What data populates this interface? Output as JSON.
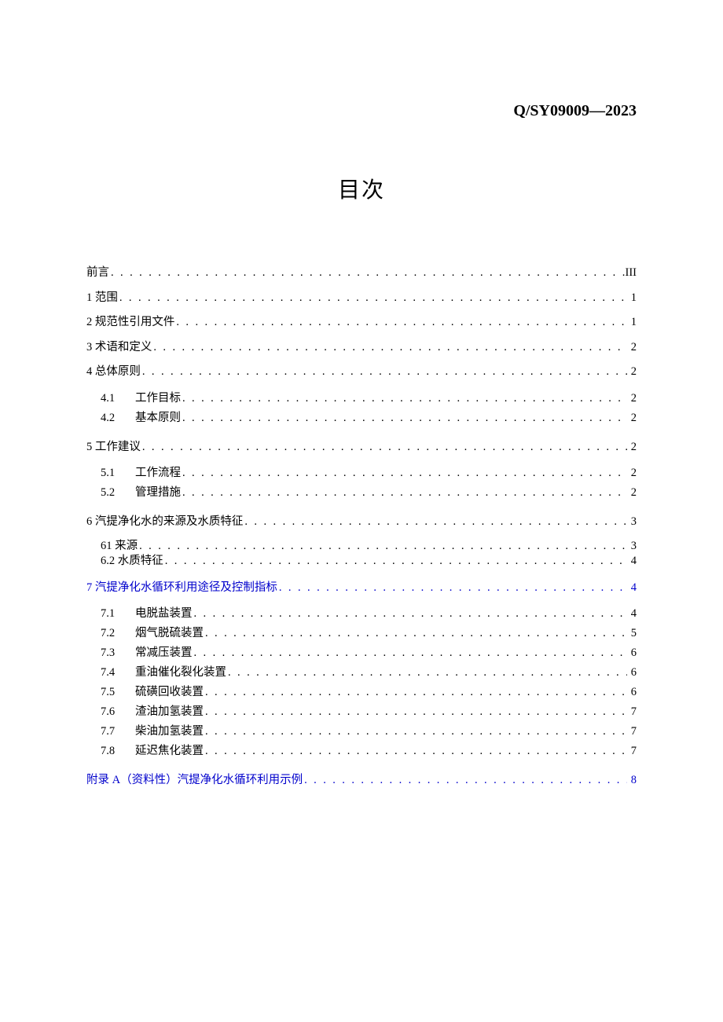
{
  "header": {
    "code": "Q/SY09009—2023"
  },
  "title": "目次",
  "toc": {
    "preface": {
      "label": "前言",
      "page": "III"
    },
    "s1": {
      "num": "1",
      "label": "范围",
      "page": "1"
    },
    "s2": {
      "num": "2",
      "label": "规范性引用文件",
      "page": "1"
    },
    "s3": {
      "num": "3",
      "label": "术语和定义",
      "page": "2"
    },
    "s4": {
      "num": "4",
      "label": "总体原则",
      "page": "2",
      "items": [
        {
          "num": "4.1",
          "label": "工作目标",
          "page": "2"
        },
        {
          "num": "4.2",
          "label": "基本原则",
          "page": "2"
        }
      ]
    },
    "s5": {
      "num": "5",
      "label": "工作建议",
      "page": "2",
      "items": [
        {
          "num": "5.1",
          "label": "工作流程",
          "page": "2"
        },
        {
          "num": "5.2",
          "label": "管理措施",
          "page": "2"
        }
      ]
    },
    "s6": {
      "num": "6",
      "label": "汽提净化水的来源及水质特征",
      "page": "3",
      "items": [
        {
          "num": "61",
          "label": "来源",
          "page": "3"
        },
        {
          "num": "6.2",
          "label": "水质特征",
          "page": "4"
        }
      ]
    },
    "s7": {
      "num": "7",
      "label": "汽提净化水循环利用途径及控制指标",
      "page": "4",
      "items": [
        {
          "num": "7.1",
          "label": "电脱盐装置",
          "page": "4"
        },
        {
          "num": "7.2",
          "label": "烟气脱硫装置",
          "page": "5"
        },
        {
          "num": "7.3",
          "label": "常减压装置",
          "page": "6"
        },
        {
          "num": "7.4",
          "label": "重油催化裂化装置",
          "page": "6"
        },
        {
          "num": "7.5",
          "label": "硫磺回收装置",
          "page": "6"
        },
        {
          "num": "7.6",
          "label": "渣油加氢装置",
          "page": "7"
        },
        {
          "num": "7.7",
          "label": "柴油加氢装置",
          "page": "7"
        },
        {
          "num": "7.8",
          "label": "延迟焦化装置",
          "page": "7"
        }
      ]
    },
    "appendixA": {
      "label": "附录 A（资料性）汽提净化水循环利用示例",
      "page": "8"
    }
  }
}
